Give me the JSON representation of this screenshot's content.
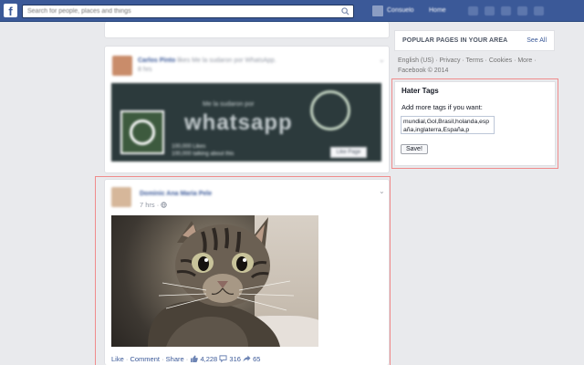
{
  "topbar": {
    "search_placeholder": "Search for people, places and things",
    "user_name": "Consuelo",
    "home_label": "Home"
  },
  "feed": {
    "page_post": {
      "author": "Carlos Pinto",
      "action": "likes Me la sudaron por WhatsApp.",
      "time": "8 hrs",
      "banner_caption": "Me la sudaron por",
      "banner_word": "whatsapp",
      "banner_stats": [
        "100,000 Likes",
        "100,000 talking about this"
      ],
      "like_page_label": "Like Page"
    },
    "photo_post": {
      "author": "Dominic Ana Maria Pele",
      "time": "7 hrs · ",
      "actions": {
        "like": "Like",
        "comment": "Comment",
        "share": "Share",
        "likes_count": "4,228",
        "comments_count": "316",
        "shares_count": "65"
      }
    }
  },
  "sidebar": {
    "popular_title": "POPULAR PAGES IN YOUR AREA",
    "see_all": "See All",
    "footer": "English (US) · Privacy · Terms · Cookies · More · Facebook © 2014"
  },
  "hater_tags": {
    "title": "Hater Tags",
    "subtitle": "Add more tags if you want:",
    "tags_value": "mundial,Gol,Brasil,holanda,españa,inglaterra,España,p",
    "save_label": "Save!"
  },
  "colors": {
    "brand_blue": "#3b5998",
    "highlight_red": "#f08c8c",
    "page_bg": "#e9eaed"
  }
}
